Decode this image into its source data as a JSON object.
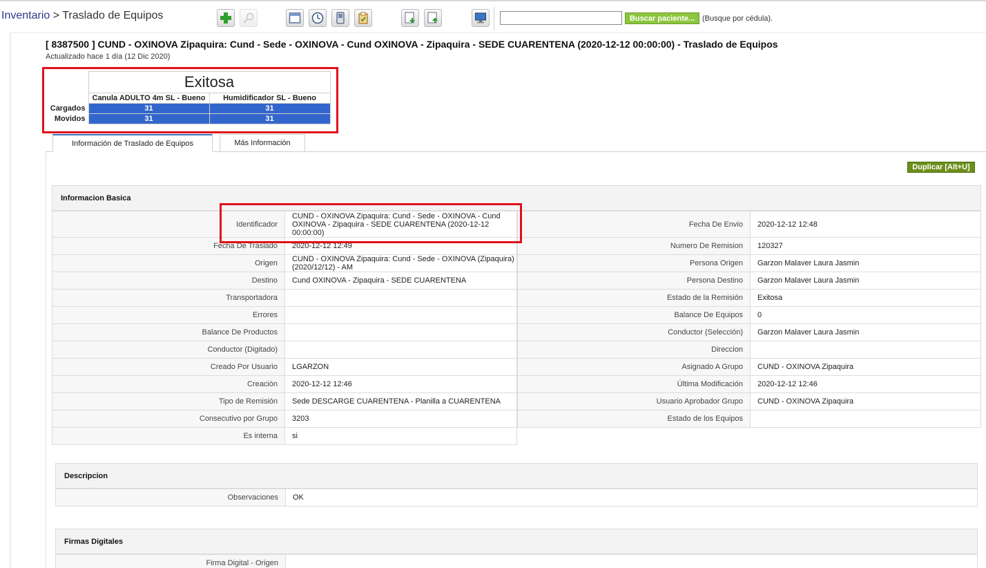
{
  "header": {
    "breadcrumb_root": "Inventario",
    "breadcrumb_sep": ">",
    "breadcrumb_current": "Traslado de Equipos",
    "toolbar_icons": [
      "add-icon",
      "search-icon",
      "window-icon",
      "clock-icon",
      "mobile-icon",
      "clipboard-icon",
      "download-document-icon",
      "upload-document-icon",
      "monitor-icon"
    ],
    "search_placeholder": "",
    "search_button": "Buscar paciente...",
    "search_hint": "(Busque por cédula)."
  },
  "record": {
    "title": "[ 8387500 ] CUND - OXINOVA Zipaquira: Cund - Sede - OXINOVA - Cund OXINOVA - Zipaquira - SEDE CUARENTENA (2020-12-12 00:00:00) - Traslado de Equipos",
    "updated": "Actualizado hace 1 día (12 Dic 2020)"
  },
  "summary": {
    "status": "Exitosa",
    "columns": [
      "Canula ADULTO 4m SL - Bueno",
      "Humidificador SL - Bueno"
    ],
    "rows": [
      {
        "label": "Cargados",
        "values": [
          "31",
          "31"
        ]
      },
      {
        "label": "Movidos",
        "values": [
          "31",
          "31"
        ]
      }
    ]
  },
  "tabs": [
    "Información de Traslado de Equipos",
    "Más Información"
  ],
  "duplicate_button": "Duplicar [Alt+U]",
  "basic": {
    "heading": "Informacion Basica",
    "left": [
      {
        "k": "Identificador",
        "v": "  CUND - OXINOVA Zipaquira: Cund - Sede - OXINOVA - Cund OXINOVA - Zipaquira - SEDE CUARENTENA (2020-12-12 00:00:00)"
      },
      {
        "k": "Fecha De Traslado",
        "v": "2020-12-12 12:49"
      },
      {
        "k": "Origen",
        "v": "CUND - OXINOVA Zipaquira: Cund - Sede - OXINOVA (Zipaquira) (2020/12/12) - AM"
      },
      {
        "k": "Destino",
        "v": "Cund OXINOVA - Zipaquira - SEDE CUARENTENA"
      },
      {
        "k": "Transportadora",
        "v": ""
      },
      {
        "k": "Errores",
        "v": ""
      },
      {
        "k": "Balance De Productos",
        "v": ""
      },
      {
        "k": "Conductor (Digitado)",
        "v": ""
      },
      {
        "k": "Creado Por Usuario",
        "v": "LGARZON"
      },
      {
        "k": "Creación",
        "v": "2020-12-12 12:46"
      },
      {
        "k": "Tipo de Remisión",
        "v": "Sede DESCARGE CUARENTENA - Planilla a CUARENTENA"
      },
      {
        "k": "Consecutivo por Grupo",
        "v": "3203"
      },
      {
        "k": "Es interna",
        "v": "si"
      }
    ],
    "right": [
      {
        "k": "Fecha De Envio",
        "v": "2020-12-12 12:48"
      },
      {
        "k": "Numero De Remision",
        "v": "120327"
      },
      {
        "k": "Persona Origen",
        "v": "Garzon Malaver Laura Jasmin"
      },
      {
        "k": "Persona Destino",
        "v": "Garzon Malaver Laura Jasmin"
      },
      {
        "k": "Estado de la Remisión",
        "v": "Exitosa"
      },
      {
        "k": "Balance De Equipos",
        "v": "0"
      },
      {
        "k": "Conductor (Selección)",
        "v": "Garzon Malaver Laura Jasmin"
      },
      {
        "k": "Direccion",
        "v": ""
      },
      {
        "k": "Asignado A Grupo",
        "v": "CUND - OXINOVA Zipaquira"
      },
      {
        "k": "Última Modificación",
        "v": "2020-12-12 12:46"
      },
      {
        "k": "Usuario Aprobador Grupo",
        "v": "CUND - OXINOVA Zipaquira"
      },
      {
        "k": "Estado de los Equipos",
        "v": ""
      }
    ]
  },
  "description": {
    "heading": "Descripcion",
    "rows": [
      {
        "k": "Observaciones",
        "v": "OK"
      }
    ]
  },
  "signatures": {
    "heading": "Firmas Digitales",
    "rows": [
      {
        "k": "Firma Digital - Origen",
        "v": ""
      }
    ]
  },
  "colors": {
    "accent_green": "#8cc63e",
    "dup_green": "#6c8e1b",
    "cell_blue": "#3366cc",
    "highlight_red": "#e0101a"
  }
}
